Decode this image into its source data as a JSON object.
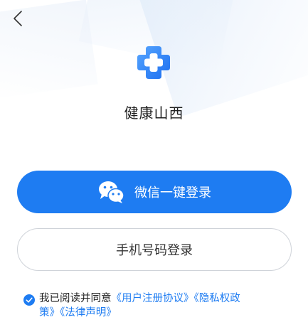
{
  "app": {
    "name": "健康山西"
  },
  "nav": {
    "back_icon": "chevron-left"
  },
  "login": {
    "wechat_label": "微信一键登录",
    "wechat_icon": "wechat",
    "phone_label": "手机号码登录"
  },
  "agreement": {
    "checked": true,
    "prefix": "我已阅读并同意",
    "user_agreement": "《用户注册协议》",
    "privacy_policy_part1": "《隐私权政",
    "privacy_policy_part2": "策》",
    "legal_notice": "《法律声明》"
  },
  "colors": {
    "primary": "#1e7cf2",
    "logo_gradient_start": "#57a6ff",
    "logo_gradient_end": "#1d6ff0"
  }
}
